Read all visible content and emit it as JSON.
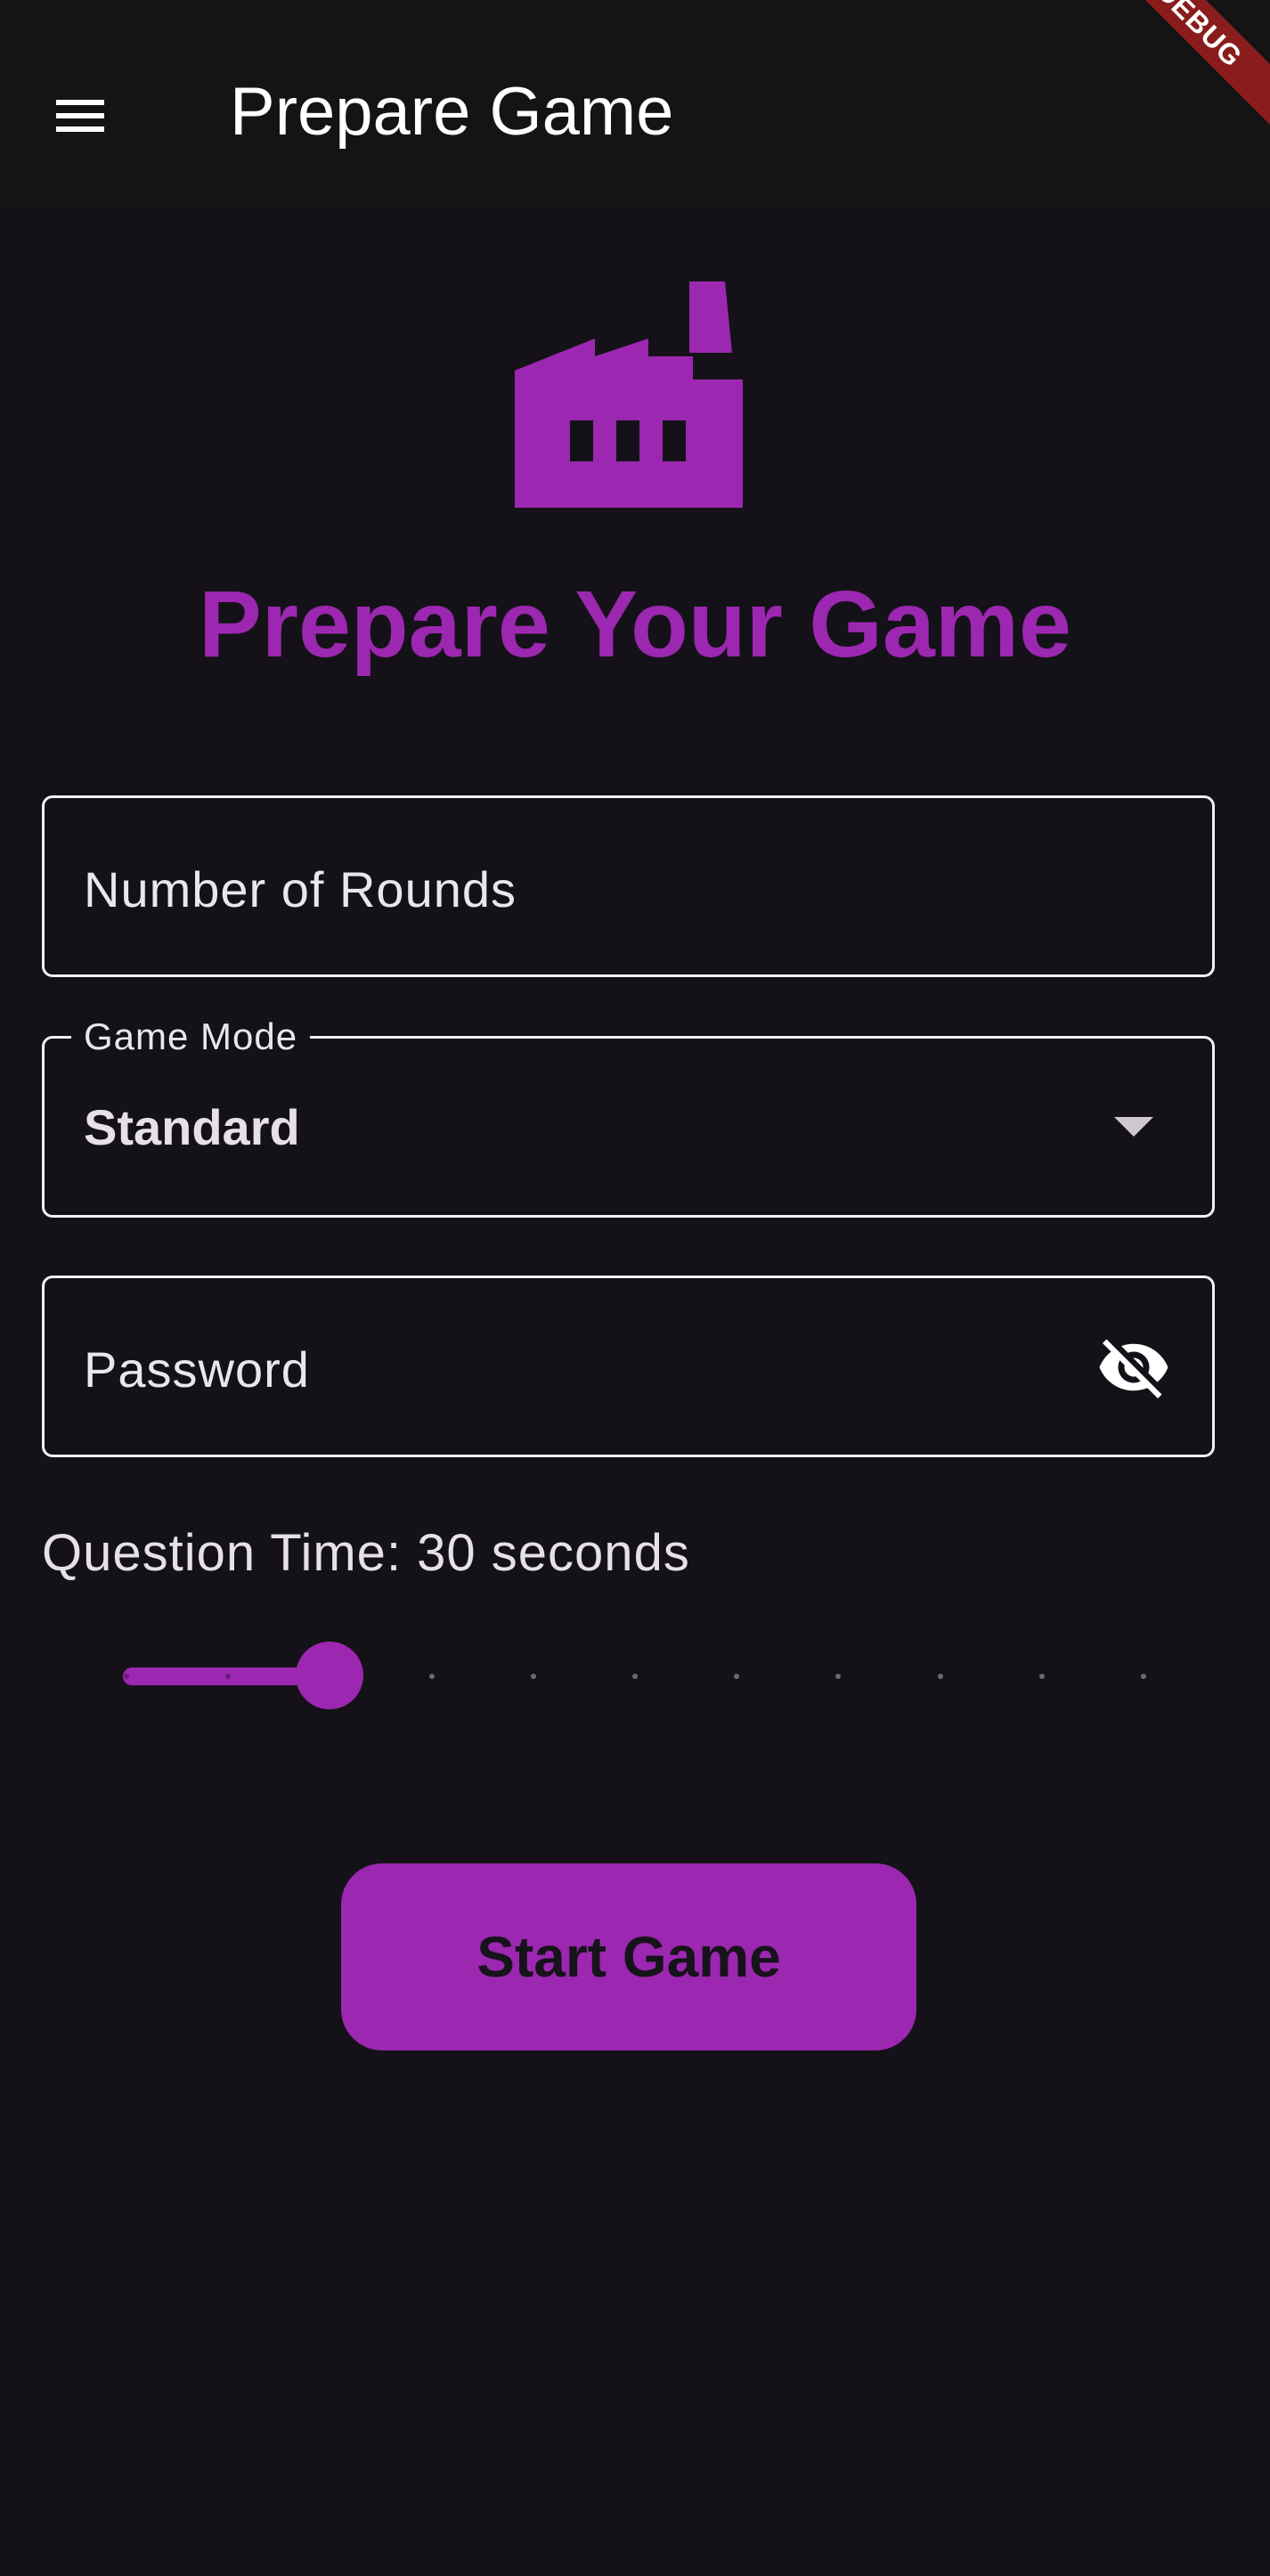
{
  "app_bar": {
    "title": "Prepare Game",
    "menu_icon": "menu-icon",
    "debug_banner": "DEBUG"
  },
  "hero": {
    "icon": "factory-icon",
    "heading": "Prepare Your Game"
  },
  "form": {
    "rounds": {
      "label": "Number of Rounds",
      "value": ""
    },
    "game_mode": {
      "label": "Game Mode",
      "selected": "Standard"
    },
    "password": {
      "label": "Password",
      "value": "",
      "visibility_icon": "visibility-off-icon"
    },
    "question_time": {
      "label": "Question Time: 30 seconds",
      "value": 30,
      "fraction": 0.2,
      "divisions": 11
    },
    "start_label": "Start Game"
  },
  "colors": {
    "accent": "#9c27b0",
    "background": "#141218",
    "app_bar": "#141414",
    "debug_ribbon": "#8a1c1c"
  }
}
